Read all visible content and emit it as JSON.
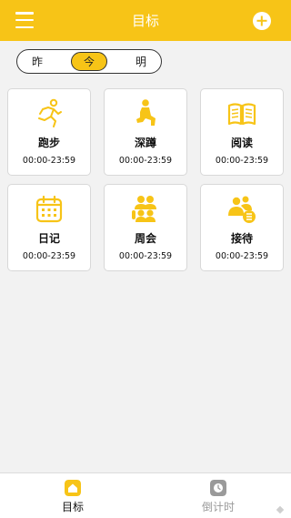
{
  "header": {
    "title": "目标"
  },
  "segment": {
    "items": [
      "昨",
      "今",
      "明"
    ],
    "selected": "今"
  },
  "cards": [
    {
      "icon": "running-icon",
      "name": "跑步",
      "time": "00:00-23:59"
    },
    {
      "icon": "squat-icon",
      "name": "深蹲",
      "time": "00:00-23:59"
    },
    {
      "icon": "book-icon",
      "name": "阅读",
      "time": "00:00-23:59"
    },
    {
      "icon": "calendar-icon",
      "name": "日记",
      "time": "00:00-23:59"
    },
    {
      "icon": "meeting-icon",
      "name": "周会",
      "time": "00:00-23:59"
    },
    {
      "icon": "reception-icon",
      "name": "接待",
      "time": "00:00-23:59"
    }
  ],
  "tabbar": {
    "items": [
      {
        "label": "目标",
        "icon": "home-icon",
        "active": true
      },
      {
        "label": "倒计时",
        "icon": "clock-icon",
        "active": false
      }
    ]
  },
  "colors": {
    "accent": "#f7c417",
    "background": "#f2f2f2",
    "inactive": "#999999"
  }
}
